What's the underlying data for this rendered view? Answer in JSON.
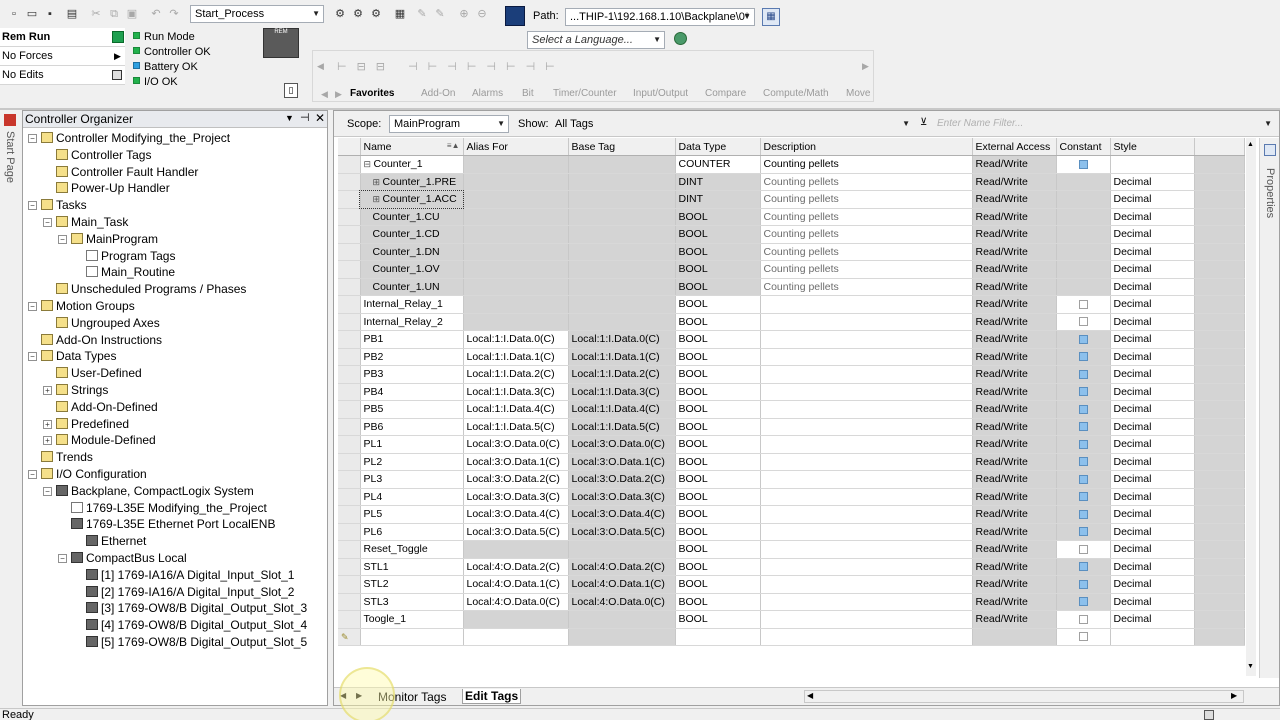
{
  "toolbar": {
    "routine_combo": "Start_Process",
    "path_label": "Path:",
    "path_value": "...THIP-1\\192.168.1.10\\Backplane\\0*",
    "language_placeholder": "Select a Language..."
  },
  "status": {
    "mode": "Rem Run",
    "forces": "No Forces",
    "edits": "No Edits",
    "rem_badge": "REM",
    "indicators": [
      "Run Mode",
      "Controller OK",
      "Battery OK",
      "I/O OK"
    ]
  },
  "instruction_tabs": [
    "Favorites",
    "Add-On",
    "Alarms",
    "Bit",
    "Timer/Counter",
    "Input/Output",
    "Compare",
    "Compute/Math",
    "Move"
  ],
  "organizer": {
    "title": "Controller Organizer",
    "side_tab": "Start Page",
    "items": [
      {
        "label": "Controller Modifying_the_Project",
        "level": 0
      },
      {
        "label": "Controller Tags",
        "level": 1
      },
      {
        "label": "Controller Fault Handler",
        "level": 1
      },
      {
        "label": "Power-Up Handler",
        "level": 1
      },
      {
        "label": "Tasks",
        "level": 0
      },
      {
        "label": "Main_Task",
        "level": 1
      },
      {
        "label": "MainProgram",
        "level": 2
      },
      {
        "label": "Program Tags",
        "level": 3
      },
      {
        "label": "Main_Routine",
        "level": 3
      },
      {
        "label": "Unscheduled Programs / Phases",
        "level": 1
      },
      {
        "label": "Motion Groups",
        "level": 0
      },
      {
        "label": "Ungrouped Axes",
        "level": 1
      },
      {
        "label": "Add-On Instructions",
        "level": 0
      },
      {
        "label": "Data Types",
        "level": 0
      },
      {
        "label": "User-Defined",
        "level": 1
      },
      {
        "label": "Strings",
        "level": 1
      },
      {
        "label": "Add-On-Defined",
        "level": 1
      },
      {
        "label": "Predefined",
        "level": 1
      },
      {
        "label": "Module-Defined",
        "level": 1
      },
      {
        "label": "Trends",
        "level": 0
      },
      {
        "label": "I/O Configuration",
        "level": 0
      },
      {
        "label": "Backplane, CompactLogix System",
        "level": 1
      },
      {
        "label": "1769-L35E Modifying_the_Project",
        "level": 2
      },
      {
        "label": "1769-L35E Ethernet Port LocalENB",
        "level": 2
      },
      {
        "label": "Ethernet",
        "level": 3
      },
      {
        "label": "CompactBus Local",
        "level": 2
      },
      {
        "label": "[1] 1769-IA16/A Digital_Input_Slot_1",
        "level": 3
      },
      {
        "label": "[2] 1769-IA16/A Digital_Input_Slot_2",
        "level": 3
      },
      {
        "label": "[3] 1769-OW8/B Digital_Output_Slot_3",
        "level": 3
      },
      {
        "label": "[4] 1769-OW8/B Digital_Output_Slot_4",
        "level": 3
      },
      {
        "label": "[5] 1769-OW8/B Digital_Output_Slot_5",
        "level": 3
      }
    ]
  },
  "tags_panel": {
    "scope_label": "Scope:",
    "scope_value": "MainProgram",
    "show_label": "Show:",
    "show_value": "All Tags",
    "filter_placeholder": "Enter Name Filter...",
    "columns": [
      "Name",
      "Alias For",
      "Base Tag",
      "Data Type",
      "Description",
      "External Access",
      "Constant",
      "Style"
    ],
    "properties_tab": "Properties",
    "rows": [
      {
        "name": "Counter_1",
        "alias": "",
        "base": "",
        "type": "COUNTER",
        "desc": "Counting pellets",
        "access": "Read/Write",
        "constant": "blue",
        "style": "",
        "expander": "-",
        "sub": false
      },
      {
        "name": "Counter_1.PRE",
        "alias": "",
        "base": "",
        "type": "DINT",
        "desc": "Counting pellets",
        "access": "Read/Write",
        "constant": "",
        "style": "Decimal",
        "expander": "+",
        "sub": true
      },
      {
        "name": "Counter_1.ACC",
        "alias": "",
        "base": "",
        "type": "DINT",
        "desc": "Counting pellets",
        "access": "Read/Write",
        "constant": "",
        "style": "Decimal",
        "expander": "+",
        "sub": true,
        "selected": true
      },
      {
        "name": "Counter_1.CU",
        "alias": "",
        "base": "",
        "type": "BOOL",
        "desc": "Counting pellets",
        "access": "Read/Write",
        "constant": "",
        "style": "Decimal",
        "expander": "",
        "sub": true
      },
      {
        "name": "Counter_1.CD",
        "alias": "",
        "base": "",
        "type": "BOOL",
        "desc": "Counting pellets",
        "access": "Read/Write",
        "constant": "",
        "style": "Decimal",
        "expander": "",
        "sub": true
      },
      {
        "name": "Counter_1.DN",
        "alias": "",
        "base": "",
        "type": "BOOL",
        "desc": "Counting pellets",
        "access": "Read/Write",
        "constant": "",
        "style": "Decimal",
        "expander": "",
        "sub": true
      },
      {
        "name": "Counter_1.OV",
        "alias": "",
        "base": "",
        "type": "BOOL",
        "desc": "Counting pellets",
        "access": "Read/Write",
        "constant": "",
        "style": "Decimal",
        "expander": "",
        "sub": true
      },
      {
        "name": "Counter_1.UN",
        "alias": "",
        "base": "",
        "type": "BOOL",
        "desc": "Counting pellets",
        "access": "Read/Write",
        "constant": "",
        "style": "Decimal",
        "expander": "",
        "sub": true
      },
      {
        "name": "Internal_Relay_1",
        "alias": "",
        "base": "",
        "type": "BOOL",
        "desc": "",
        "access": "Read/Write",
        "constant": "white",
        "style": "Decimal",
        "expander": "",
        "sub": false
      },
      {
        "name": "Internal_Relay_2",
        "alias": "",
        "base": "",
        "type": "BOOL",
        "desc": "",
        "access": "Read/Write",
        "constant": "white",
        "style": "Decimal",
        "expander": "",
        "sub": false
      },
      {
        "name": "PB1",
        "alias": "Local:1:I.Data.0(C)",
        "base": "Local:1:I.Data.0(C)",
        "type": "BOOL",
        "desc": "",
        "access": "Read/Write",
        "constant": "blue",
        "style": "Decimal",
        "expander": "",
        "sub": false
      },
      {
        "name": "PB2",
        "alias": "Local:1:I.Data.1(C)",
        "base": "Local:1:I.Data.1(C)",
        "type": "BOOL",
        "desc": "",
        "access": "Read/Write",
        "constant": "blue",
        "style": "Decimal",
        "expander": "",
        "sub": false
      },
      {
        "name": "PB3",
        "alias": "Local:1:I.Data.2(C)",
        "base": "Local:1:I.Data.2(C)",
        "type": "BOOL",
        "desc": "",
        "access": "Read/Write",
        "constant": "blue",
        "style": "Decimal",
        "expander": "",
        "sub": false
      },
      {
        "name": "PB4",
        "alias": "Local:1:I.Data.3(C)",
        "base": "Local:1:I.Data.3(C)",
        "type": "BOOL",
        "desc": "",
        "access": "Read/Write",
        "constant": "blue",
        "style": "Decimal",
        "expander": "",
        "sub": false
      },
      {
        "name": "PB5",
        "alias": "Local:1:I.Data.4(C)",
        "base": "Local:1:I.Data.4(C)",
        "type": "BOOL",
        "desc": "",
        "access": "Read/Write",
        "constant": "blue",
        "style": "Decimal",
        "expander": "",
        "sub": false
      },
      {
        "name": "PB6",
        "alias": "Local:1:I.Data.5(C)",
        "base": "Local:1:I.Data.5(C)",
        "type": "BOOL",
        "desc": "",
        "access": "Read/Write",
        "constant": "blue",
        "style": "Decimal",
        "expander": "",
        "sub": false
      },
      {
        "name": "PL1",
        "alias": "Local:3:O.Data.0(C)",
        "base": "Local:3:O.Data.0(C)",
        "type": "BOOL",
        "desc": "",
        "access": "Read/Write",
        "constant": "blue",
        "style": "Decimal",
        "expander": "",
        "sub": false
      },
      {
        "name": "PL2",
        "alias": "Local:3:O.Data.1(C)",
        "base": "Local:3:O.Data.1(C)",
        "type": "BOOL",
        "desc": "",
        "access": "Read/Write",
        "constant": "blue",
        "style": "Decimal",
        "expander": "",
        "sub": false
      },
      {
        "name": "PL3",
        "alias": "Local:3:O.Data.2(C)",
        "base": "Local:3:O.Data.2(C)",
        "type": "BOOL",
        "desc": "",
        "access": "Read/Write",
        "constant": "blue",
        "style": "Decimal",
        "expander": "",
        "sub": false
      },
      {
        "name": "PL4",
        "alias": "Local:3:O.Data.3(C)",
        "base": "Local:3:O.Data.3(C)",
        "type": "BOOL",
        "desc": "",
        "access": "Read/Write",
        "constant": "blue",
        "style": "Decimal",
        "expander": "",
        "sub": false
      },
      {
        "name": "PL5",
        "alias": "Local:3:O.Data.4(C)",
        "base": "Local:3:O.Data.4(C)",
        "type": "BOOL",
        "desc": "",
        "access": "Read/Write",
        "constant": "blue",
        "style": "Decimal",
        "expander": "",
        "sub": false
      },
      {
        "name": "PL6",
        "alias": "Local:3:O.Data.5(C)",
        "base": "Local:3:O.Data.5(C)",
        "type": "BOOL",
        "desc": "",
        "access": "Read/Write",
        "constant": "blue",
        "style": "Decimal",
        "expander": "",
        "sub": false
      },
      {
        "name": "Reset_Toggle",
        "alias": "",
        "base": "",
        "type": "BOOL",
        "desc": "",
        "access": "Read/Write",
        "constant": "white",
        "style": "Decimal",
        "expander": "",
        "sub": false
      },
      {
        "name": "STL1",
        "alias": "Local:4:O.Data.2(C)",
        "base": "Local:4:O.Data.2(C)",
        "type": "BOOL",
        "desc": "",
        "access": "Read/Write",
        "constant": "blue",
        "style": "Decimal",
        "expander": "",
        "sub": false
      },
      {
        "name": "STL2",
        "alias": "Local:4:O.Data.1(C)",
        "base": "Local:4:O.Data.1(C)",
        "type": "BOOL",
        "desc": "",
        "access": "Read/Write",
        "constant": "blue",
        "style": "Decimal",
        "expander": "",
        "sub": false
      },
      {
        "name": "STL3",
        "alias": "Local:4:O.Data.0(C)",
        "base": "Local:4:O.Data.0(C)",
        "type": "BOOL",
        "desc": "",
        "access": "Read/Write",
        "constant": "blue",
        "style": "Decimal",
        "expander": "",
        "sub": false
      },
      {
        "name": "Toogle_1",
        "alias": "",
        "base": "",
        "type": "BOOL",
        "desc": "",
        "access": "Read/Write",
        "constant": "white",
        "style": "Decimal",
        "expander": "",
        "sub": false
      }
    ],
    "bottom_tabs": [
      "Monitor Tags",
      "Edit Tags"
    ]
  },
  "statusbar": {
    "text": "Ready"
  },
  "colors": {
    "gray_cell": "#d4d4d4",
    "panel_border": "#a0a0a0",
    "selected_blue": "#cce4f7"
  }
}
